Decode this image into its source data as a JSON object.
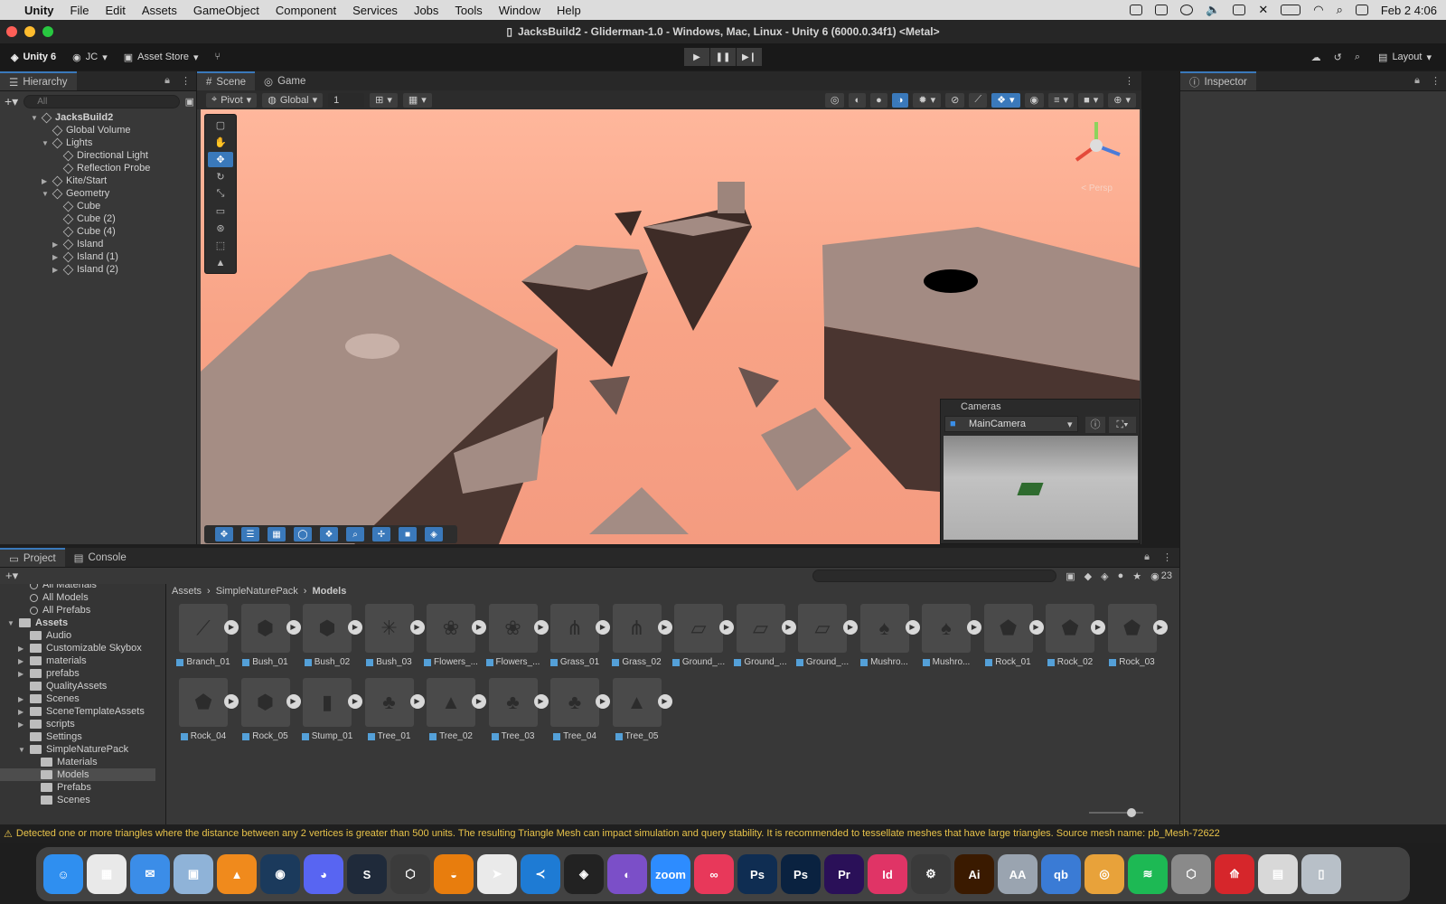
{
  "menubar": {
    "items": [
      "Unity",
      "File",
      "Edit",
      "Assets",
      "GameObject",
      "Component",
      "Services",
      "Jobs",
      "Tools",
      "Window",
      "Help"
    ],
    "clock": "Feb 2  4:06"
  },
  "window": {
    "title": "JacksBuild2 - Gliderman-1.0 - Windows, Mac, Linux - Unity 6 (6000.0.34f1) <Metal>"
  },
  "toolbar": {
    "logo": "Unity 6",
    "account": "JC",
    "asset_store": "Asset Store",
    "layout": "Layout"
  },
  "hierarchy": {
    "tab": "Hierarchy",
    "search_placeholder": "All",
    "items": [
      {
        "label": "JacksBuild2",
        "depth": 0,
        "arrow": "▼",
        "bold": true
      },
      {
        "label": "Global Volume",
        "depth": 1,
        "arrow": ""
      },
      {
        "label": "Lights",
        "depth": 1,
        "arrow": "▼"
      },
      {
        "label": "Directional Light",
        "depth": 2,
        "arrow": ""
      },
      {
        "label": "Reflection Probe",
        "depth": 2,
        "arrow": ""
      },
      {
        "label": "Kite/Start",
        "depth": 1,
        "arrow": "▶"
      },
      {
        "label": "Geometry",
        "depth": 1,
        "arrow": "▼"
      },
      {
        "label": "Cube",
        "depth": 2,
        "arrow": ""
      },
      {
        "label": "Cube (2)",
        "depth": 2,
        "arrow": ""
      },
      {
        "label": "Cube (4)",
        "depth": 2,
        "arrow": ""
      },
      {
        "label": "Island",
        "depth": 2,
        "arrow": "▶"
      },
      {
        "label": "Island (1)",
        "depth": 2,
        "arrow": "▶"
      },
      {
        "label": "Island (2)",
        "depth": 2,
        "arrow": "▶"
      }
    ]
  },
  "scene": {
    "tabs": [
      "Scene",
      "Game"
    ],
    "pivot": "Pivot",
    "global": "Global",
    "grid_value": "1",
    "gizmo_label": "< Persp"
  },
  "cameras": {
    "title": "Cameras",
    "selected": "MainCamera"
  },
  "inspector": {
    "tab": "Inspector"
  },
  "project": {
    "tabs": [
      "Project",
      "Console"
    ],
    "count": "23",
    "breadcrumb": [
      "Assets",
      "SimpleNaturePack",
      "Models"
    ],
    "tree": [
      {
        "label": "All Materials",
        "depth": 1,
        "kind": "search"
      },
      {
        "label": "All Models",
        "depth": 1,
        "kind": "search"
      },
      {
        "label": "All Prefabs",
        "depth": 1,
        "kind": "search"
      },
      {
        "label": "Assets",
        "depth": 0,
        "kind": "folder",
        "arrow": "▼",
        "bold": true
      },
      {
        "label": "Audio",
        "depth": 1,
        "kind": "folder",
        "arrow": ""
      },
      {
        "label": "Customizable Skybox",
        "depth": 1,
        "kind": "folder",
        "arrow": "▶"
      },
      {
        "label": "materials",
        "depth": 1,
        "kind": "folder",
        "arrow": "▶"
      },
      {
        "label": "prefabs",
        "depth": 1,
        "kind": "folder",
        "arrow": "▶"
      },
      {
        "label": "QualityAssets",
        "depth": 1,
        "kind": "folder",
        "arrow": ""
      },
      {
        "label": "Scenes",
        "depth": 1,
        "kind": "folder",
        "arrow": "▶"
      },
      {
        "label": "SceneTemplateAssets",
        "depth": 1,
        "kind": "folder",
        "arrow": "▶"
      },
      {
        "label": "scripts",
        "depth": 1,
        "kind": "folder",
        "arrow": "▶"
      },
      {
        "label": "Settings",
        "depth": 1,
        "kind": "folder",
        "arrow": ""
      },
      {
        "label": "SimpleNaturePack",
        "depth": 1,
        "kind": "folder",
        "arrow": "▼"
      },
      {
        "label": "Materials",
        "depth": 2,
        "kind": "folder",
        "arrow": ""
      },
      {
        "label": "Models",
        "depth": 2,
        "kind": "folder",
        "arrow": "",
        "selected": true
      },
      {
        "label": "Prefabs",
        "depth": 2,
        "kind": "folder",
        "arrow": ""
      },
      {
        "label": "Scenes",
        "depth": 2,
        "kind": "folder",
        "arrow": ""
      }
    ],
    "assets": [
      "Branch_01",
      "Bush_01",
      "Bush_02",
      "Bush_03",
      "Flowers_...",
      "Flowers_...",
      "Grass_01",
      "Grass_02",
      "Ground_...",
      "Ground_...",
      "Ground_...",
      "Mushro...",
      "Mushro...",
      "Rock_01",
      "Rock_02",
      "Rock_03",
      "Rock_04",
      "Rock_05",
      "Stump_01",
      "Tree_01",
      "Tree_02",
      "Tree_03",
      "Tree_04",
      "Tree_05"
    ]
  },
  "status": {
    "message": "Detected one or more triangles where the distance between any 2 vertices is greater than 500 units. The resulting Triangle Mesh can impact simulation and query stability. It is recommended to tessellate meshes that have large triangles. Source mesh name: pb_Mesh-72622",
    "color": "#e8c34a"
  },
  "dock": {
    "apps": [
      {
        "name": "finder",
        "glyph": "☺",
        "color": "#2f8ff0"
      },
      {
        "name": "launchpad",
        "glyph": "▦",
        "color": "#e9e9e9"
      },
      {
        "name": "mail",
        "glyph": "✉",
        "color": "#3b8de8"
      },
      {
        "name": "preview",
        "glyph": "▣",
        "color": "#8fb3d8"
      },
      {
        "name": "vlc",
        "glyph": "▲",
        "color": "#f08a1c"
      },
      {
        "name": "steam",
        "glyph": "◉",
        "color": "#1b3a5c"
      },
      {
        "name": "discord",
        "glyph": "◕",
        "color": "#5865f2"
      },
      {
        "name": "sketchbook",
        "glyph": "S",
        "color": "#1f2a3a"
      },
      {
        "name": "unity-hub",
        "glyph": "⬡",
        "color": "#3b3b3b"
      },
      {
        "name": "blender",
        "glyph": "◒",
        "color": "#e87d0d"
      },
      {
        "name": "cursor",
        "glyph": "➤",
        "color": "#eaeaea"
      },
      {
        "name": "vscode",
        "glyph": "≺",
        "color": "#1e7bd4"
      },
      {
        "name": "unity",
        "glyph": "◈",
        "color": "#222222"
      },
      {
        "name": "github",
        "glyph": "◐",
        "color": "#7b4fc8"
      },
      {
        "name": "zoom",
        "glyph": "zoom",
        "color": "#2d8cff"
      },
      {
        "name": "creative-cloud",
        "glyph": "∞",
        "color": "#e8385a"
      },
      {
        "name": "photoshop",
        "glyph": "Ps",
        "color": "#0f2d52"
      },
      {
        "name": "photoshop-2",
        "glyph": "Ps",
        "color": "#0a2240"
      },
      {
        "name": "premiere",
        "glyph": "Pr",
        "color": "#2a1058"
      },
      {
        "name": "indesign",
        "glyph": "Id",
        "color": "#e03466"
      },
      {
        "name": "acrobat-reader",
        "glyph": "⚙",
        "color": "#3a3a3a"
      },
      {
        "name": "illustrator",
        "glyph": "Ai",
        "color": "#3a1a00"
      },
      {
        "name": "font-book",
        "glyph": "AA",
        "color": "#9aa4b0"
      },
      {
        "name": "qbittorrent",
        "glyph": "qb",
        "color": "#3a7bd5"
      },
      {
        "name": "chrome",
        "glyph": "◎",
        "color": "#e8a23a"
      },
      {
        "name": "spotify",
        "glyph": "≋",
        "color": "#1db954"
      },
      {
        "name": "unity-2",
        "glyph": "⬡",
        "color": "#8a8a8a"
      },
      {
        "name": "acrobat",
        "glyph": "⟰",
        "color": "#d6262b"
      },
      {
        "name": "documents",
        "glyph": "▤",
        "color": "#d8d8d8"
      },
      {
        "name": "trash",
        "glyph": "▯",
        "color": "#b8c0c8"
      }
    ]
  }
}
